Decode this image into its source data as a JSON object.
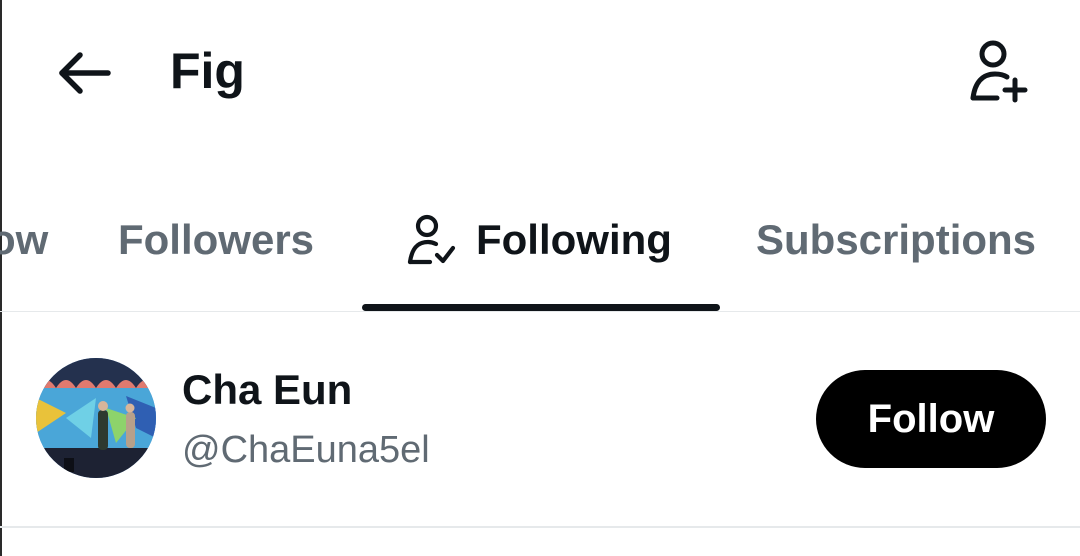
{
  "header": {
    "back_icon": "arrow-left-icon",
    "title": "Fig",
    "add_user_icon": "person-add-icon"
  },
  "tabs": [
    {
      "label": "ow",
      "active": false
    },
    {
      "label": "Followers",
      "active": false
    },
    {
      "label": "Following",
      "active": true,
      "icon": "person-check-icon"
    },
    {
      "label": "Subscriptions",
      "active": false
    }
  ],
  "users": [
    {
      "name": "Cha Eun",
      "handle": "@ChaEuna5el",
      "avatar": "avatar-photo",
      "follow_label": "Follow"
    }
  ],
  "colors": {
    "text_primary": "#0f1419",
    "text_secondary": "#606a73",
    "button_bg": "#000000",
    "button_text": "#ffffff",
    "divider": "#e6e9eb"
  }
}
